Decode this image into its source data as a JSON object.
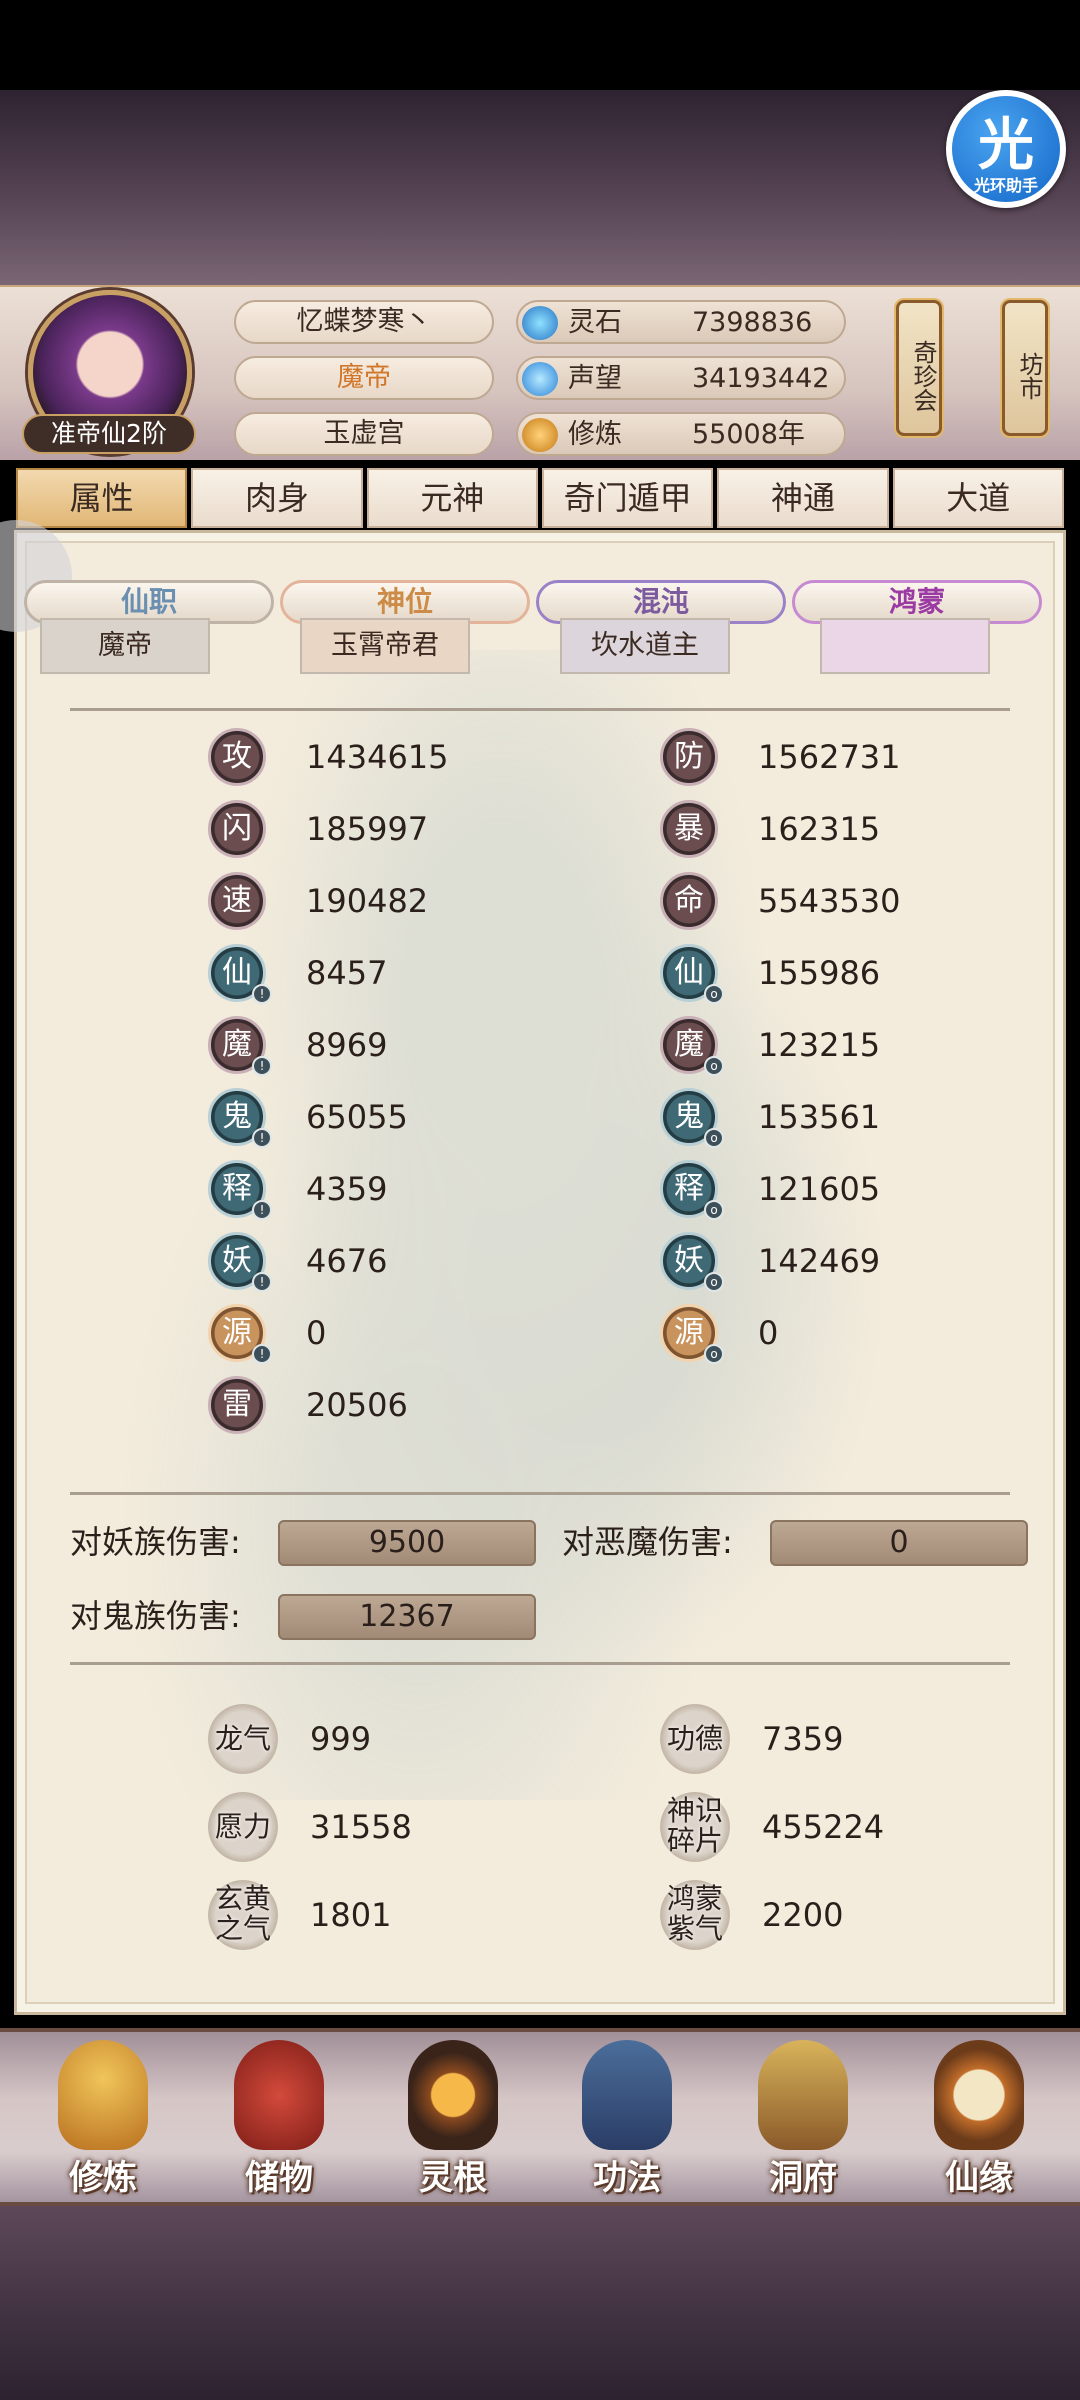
{
  "assistant_badge": {
    "glyph": "光",
    "label": "光环助手"
  },
  "player": {
    "rank": "准帝仙2阶",
    "name": "忆蝶梦寒丶",
    "title": "魔帝",
    "sect": "玉虚宫"
  },
  "resources": [
    {
      "label": "灵石",
      "value": "7398836",
      "icon": "spirit-stone-icon"
    },
    {
      "label": "声望",
      "value": "34193442",
      "icon": "prestige-icon"
    },
    {
      "label": "修炼",
      "value": "55008年",
      "icon": "cultivation-icon"
    }
  ],
  "side_buttons": [
    {
      "label": "奇珍会"
    },
    {
      "label": "坊市"
    }
  ],
  "tabs": [
    "属性",
    "肉身",
    "元神",
    "奇门遁甲",
    "神通",
    "大道"
  ],
  "categories": [
    {
      "header": "仙职",
      "value": "魔帝"
    },
    {
      "header": "神位",
      "value": "玉霄帝君"
    },
    {
      "header": "混沌",
      "value": "坎水道主"
    },
    {
      "header": "鸿蒙",
      "value": ""
    }
  ],
  "stats_left": [
    {
      "icon": "攻",
      "value": "1434615"
    },
    {
      "icon": "闪",
      "value": "185997"
    },
    {
      "icon": "速",
      "value": "190482"
    },
    {
      "icon": "仙",
      "value": "8457"
    },
    {
      "icon": "魔",
      "value": "8969"
    },
    {
      "icon": "鬼",
      "value": "65055"
    },
    {
      "icon": "释",
      "value": "4359"
    },
    {
      "icon": "妖",
      "value": "4676"
    },
    {
      "icon": "源",
      "value": "0"
    },
    {
      "icon": "雷",
      "value": "20506"
    }
  ],
  "stats_right": [
    {
      "icon": "防",
      "value": "1562731"
    },
    {
      "icon": "暴",
      "value": "162315"
    },
    {
      "icon": "命",
      "value": "5543530"
    },
    {
      "icon": "仙",
      "value": "155986"
    },
    {
      "icon": "魔",
      "value": "123215"
    },
    {
      "icon": "鬼",
      "value": "153561"
    },
    {
      "icon": "释",
      "value": "121605"
    },
    {
      "icon": "妖",
      "value": "142469"
    },
    {
      "icon": "源",
      "value": "0"
    }
  ],
  "damage": [
    {
      "label": "对妖族伤害:",
      "value": "9500"
    },
    {
      "label": "对恶魔伤害:",
      "value": "0"
    },
    {
      "label": "对鬼族伤害:",
      "value": "12367"
    }
  ],
  "misc": [
    {
      "icon": "龙气",
      "value": "999"
    },
    {
      "icon": "功德",
      "value": "7359"
    },
    {
      "icon": "愿力",
      "value": "31558"
    },
    {
      "icon": "神识碎片",
      "value": "455224"
    },
    {
      "icon": "玄黄之气",
      "value": "1801"
    },
    {
      "icon": "鸿蒙紫气",
      "value": "2200"
    }
  ],
  "bottom_nav": [
    {
      "label": "修炼",
      "icon": "cultivate-icon"
    },
    {
      "label": "储物",
      "icon": "storage-bag-icon"
    },
    {
      "label": "灵根",
      "icon": "spirit-root-icon"
    },
    {
      "label": "功法",
      "icon": "technique-book-icon"
    },
    {
      "label": "洞府",
      "icon": "cave-abode-icon"
    },
    {
      "label": "仙缘",
      "icon": "immortal-fate-icon"
    }
  ],
  "colors": {
    "accent_orange": "#d2772a",
    "panel_bg": "#f3ecdc",
    "tab_active": "#e1b777"
  }
}
